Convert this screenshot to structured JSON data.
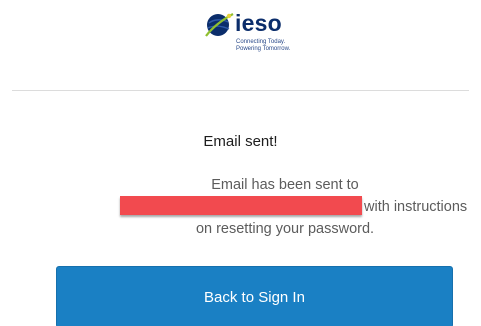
{
  "brand": {
    "name": "ieso",
    "tagline_line1": "Connecting Today.",
    "tagline_line2": "Powering Tomorrow.",
    "primary_color": "#0b2d6b",
    "accent_color": "#8fbf2f",
    "logo_icon": "globe-logo-icon"
  },
  "content": {
    "title": "Email sent!",
    "message_line1": "Email has been sent to",
    "message_line2_suffix": "with instructions",
    "message_line3": "on resetting your password.",
    "redaction_color": "#f24a4f"
  },
  "actions": {
    "back_label": "Back to Sign In",
    "button_color": "#1a80c4"
  }
}
